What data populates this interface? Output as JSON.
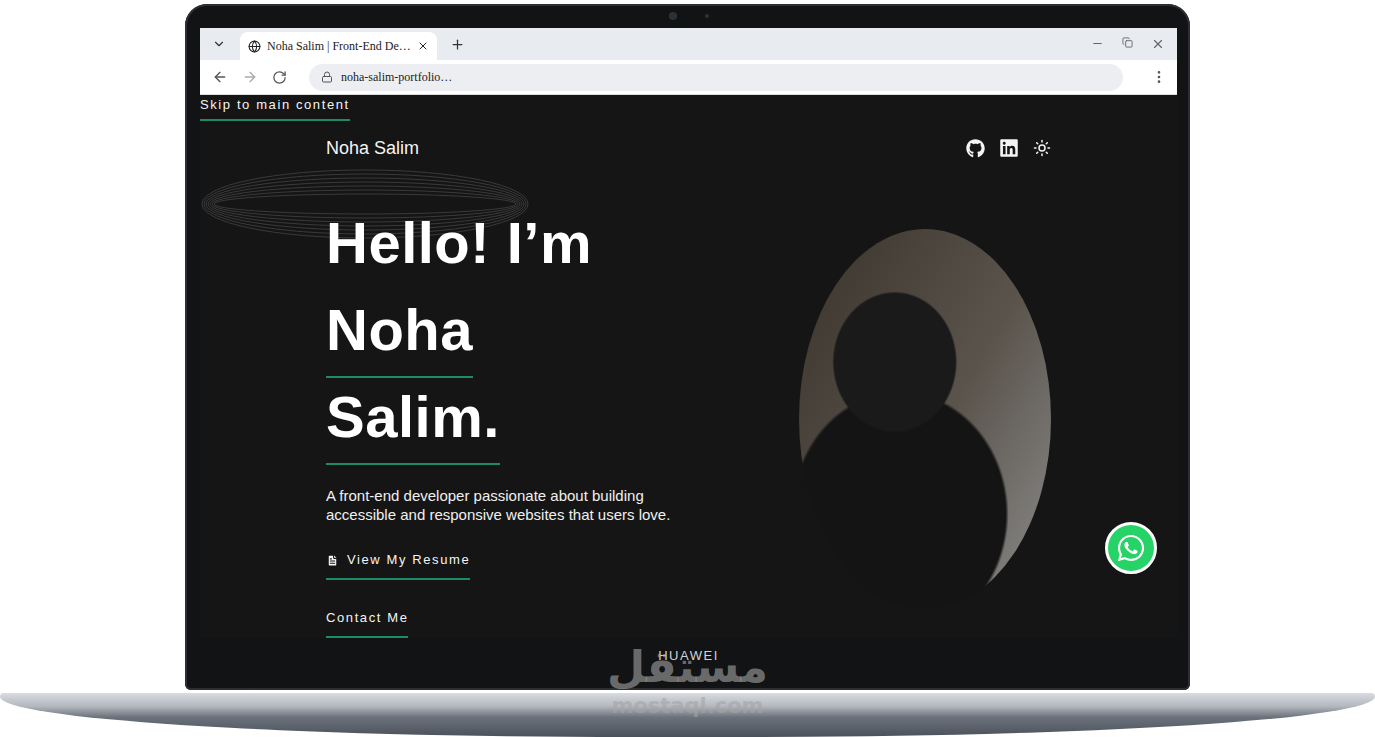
{
  "device": {
    "brand": "HUAWEI"
  },
  "browser": {
    "tabs": [
      {
        "title": "Noha Salim | Front-End De…",
        "selected": true
      }
    ],
    "address": "noha-salim-portfolio…"
  },
  "page": {
    "skip_link": "Skip to main content",
    "brand": "Noha Salim"
  },
  "hero": {
    "heading_lines": [
      {
        "text": "Hello! I’m",
        "underlined": false
      },
      {
        "text": "Noha",
        "underlined": true
      },
      {
        "text": "Salim.",
        "underlined": true
      }
    ],
    "description_lines": [
      "A front-end developer passionate about building",
      "accessible and responsive websites that users love."
    ],
    "actions": [
      {
        "label": "View My Resume",
        "kind": "resume"
      },
      {
        "label": "Contact Me",
        "kind": "contact"
      }
    ]
  },
  "watermark": {
    "arabic": "مستقل",
    "latin": "mostaql.com"
  }
}
